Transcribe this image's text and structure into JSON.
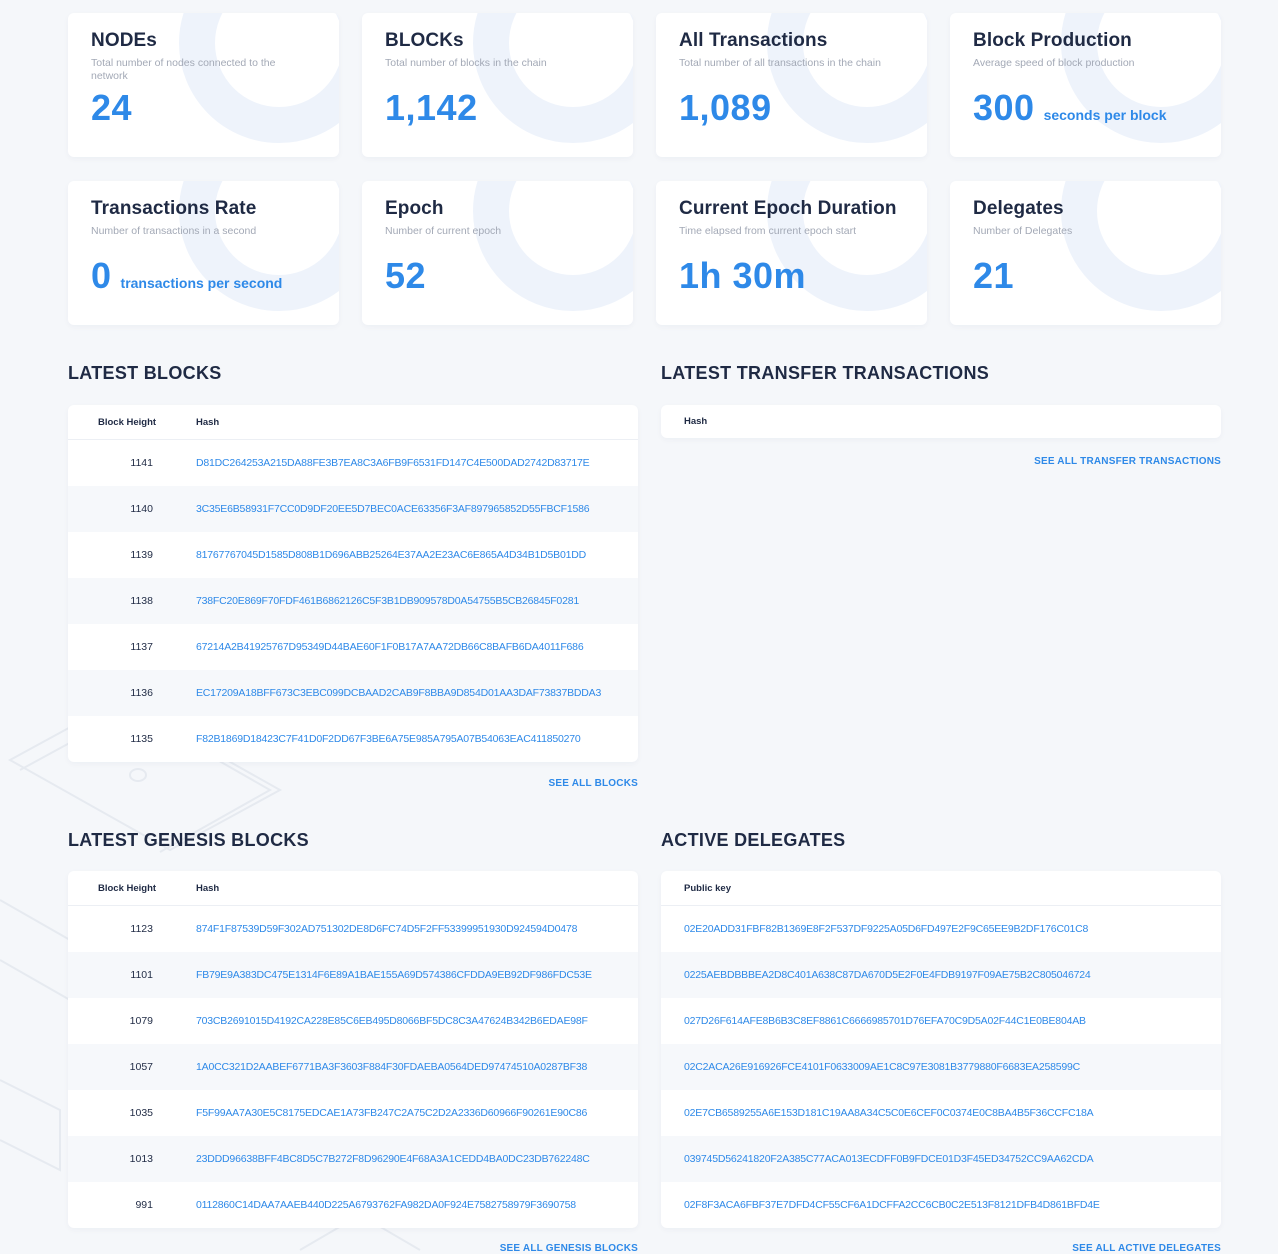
{
  "stats": [
    {
      "title": "NODEs",
      "desc": "Total number of nodes connected to the network",
      "value": "24",
      "unit": ""
    },
    {
      "title": "BLOCKs",
      "desc": "Total number of blocks in the chain",
      "value": "1,142",
      "unit": ""
    },
    {
      "title": "All Transactions",
      "desc": "Total number of all transactions in the chain",
      "value": "1,089",
      "unit": ""
    },
    {
      "title": "Block Production",
      "desc": "Average speed of block production",
      "value": "300",
      "unit": "seconds per block"
    },
    {
      "title": "Transactions Rate",
      "desc": "Number of transactions in a second",
      "value": "0",
      "unit": "transactions per second"
    },
    {
      "title": "Epoch",
      "desc": "Number of current epoch",
      "value": "52",
      "unit": ""
    },
    {
      "title": "Current Epoch Duration",
      "desc": "Time elapsed from current epoch start",
      "value": "1h 30m",
      "unit": ""
    },
    {
      "title": "Delegates",
      "desc": "Number of Delegates",
      "value": "21",
      "unit": ""
    }
  ],
  "latest_blocks": {
    "title": "LATEST BLOCKS",
    "col_height": "Block Height",
    "col_hash": "Hash",
    "rows": [
      {
        "height": "1141",
        "hash": "D81DC264253A215DA88FE3B7EA8C3A6FB9F6531FD147C4E500DAD2742D83717E"
      },
      {
        "height": "1140",
        "hash": "3C35E6B58931F7CC0D9DF20EE5D7BEC0ACE63356F3AF897965852D55FBCF1586"
      },
      {
        "height": "1139",
        "hash": "81767767045D1585D808B1D696ABB25264E37AA2E23AC6E865A4D34B1D5B01DD"
      },
      {
        "height": "1138",
        "hash": "738FC20E869F70FDF461B6862126C5F3B1DB909578D0A54755B5CB26845F0281"
      },
      {
        "height": "1137",
        "hash": "67214A2B41925767D95349D44BAE60F1F0B17A7AA72DB66C8BAFB6DA4011F686"
      },
      {
        "height": "1136",
        "hash": "EC17209A18BFF673C3EBC099DCBAAD2CAB9F8BBA9D854D01AA3DAF73837BDDA3"
      },
      {
        "height": "1135",
        "hash": "F82B1869D18423C7F41D0F2DD67F3BE6A75E985A795A07B54063EAC411850270"
      }
    ],
    "see_all": "SEE ALL BLOCKS"
  },
  "latest_transfers": {
    "title": "LATEST TRANSFER TRANSACTIONS",
    "col_hash": "Hash",
    "see_all": "SEE ALL TRANSFER TRANSACTIONS"
  },
  "genesis_blocks": {
    "title": "LATEST GENESIS BLOCKS",
    "col_height": "Block Height",
    "col_hash": "Hash",
    "rows": [
      {
        "height": "1123",
        "hash": "874F1F87539D59F302AD751302DE8D6FC74D5F2FF53399951930D924594D0478"
      },
      {
        "height": "1101",
        "hash": "FB79E9A383DC475E1314F6E89A1BAE155A69D574386CFDDA9EB92DF986FDC53E"
      },
      {
        "height": "1079",
        "hash": "703CB2691015D4192CA228E85C6EB495D8066BF5DC8C3A47624B342B6EDAE98F"
      },
      {
        "height": "1057",
        "hash": "1A0CC321D2AABEF6771BA3F3603F884F30FDAEBA0564DED97474510A0287BF38"
      },
      {
        "height": "1035",
        "hash": "F5F99AA7A30E5C8175EDCAE1A73FB247C2A75C2D2A2336D60966F90261E90C86"
      },
      {
        "height": "1013",
        "hash": "23DDD96638BFF4BC8D5C7B272F8D96290E4F68A3A1CEDD4BA0DC23DB762248C"
      },
      {
        "height": "991",
        "hash": "0112860C14DAA7AAEB440D225A6793762FA982DA0F924E7582758979F3690758"
      }
    ],
    "see_all": "SEE ALL GENESIS BLOCKS"
  },
  "active_delegates": {
    "title": "ACTIVE DELEGATES",
    "col_pk": "Public key",
    "rows": [
      "02E20ADD31FBF82B1369E8F2F537DF9225A05D6FD497E2F9C65EE9B2DF176C01C8",
      "0225AEBDBBBEA2D8C401A638C87DA670D5E2F0E4FDB9197F09AE75B2C805046724",
      "027D26F614AFE8B6B3C8EF8861C6666985701D76EFA70C9D5A02F44C1E0BE804AB",
      "02C2ACA26E916926FCE4101F0633009AE1C8C97E3081B3779880F6683EA258599C",
      "02E7CB6589255A6E153D181C19AA8A34C5C0E6CEF0C0374E0C8BA4B5F36CCFC18A",
      "039745D56241820F2A385C77ACA013ECDFF0B9FDCE01D3F45ED34752CC9AA62CDA",
      "02F8F3ACA6FBF37E7DFD4CF55CF6A1DCFFA2CC6CB0C2E513F8121DFB4D861BFD4E"
    ],
    "see_all": "SEE ALL ACTIVE DELEGATES"
  },
  "colors": {
    "accent": "#2e89e8",
    "text": "#1f2a44",
    "muted": "#a3a9b6",
    "background": "#f5f7fa"
  }
}
